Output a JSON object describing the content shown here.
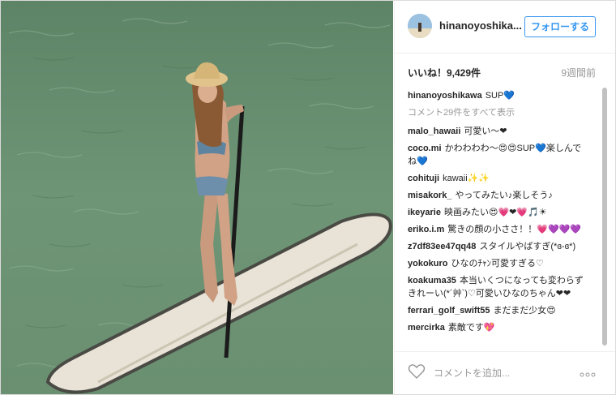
{
  "post": {
    "username": "hinanoyoshika...",
    "follow_label": "フォローする",
    "likes": "いいね！9,429件",
    "time_ago": "9週間前",
    "view_all": "コメント29件をすべて表示",
    "add_comment_placeholder": "コメントを追加...",
    "caption": {
      "user": "hinanoyoshikawa",
      "text": "SUP💙"
    },
    "comments": [
      {
        "user": "malo_hawaii",
        "text": "可愛い〜❤"
      },
      {
        "user": "coco.mi",
        "text": "かわわわわ〜😍😍SUP💙楽しんでね💙"
      },
      {
        "user": "cohituji",
        "text": "kawaii✨✨"
      },
      {
        "user": "misakork_",
        "text": "やってみたい♪楽しそう♪"
      },
      {
        "user": "ikeyarie",
        "text": "映画みたい😍💗❤💗🎵☀"
      },
      {
        "user": "eriko.i.m",
        "text": "驚きの顔の小ささ！！💗💜💜💜"
      },
      {
        "user": "z7df83ee47qq48",
        "text": "スタイルやばすぎ(*ɞ-ɞ*)"
      },
      {
        "user": "yokokuro",
        "text": "ひなのﾁｬﾝ可愛すぎる♡"
      },
      {
        "user": "koakuma35",
        "text": "本当いくつになっても変わらずきれーい(*´艸`)♡可愛いひなのちゃん❤❤"
      },
      {
        "user": "ferrari_golf_swift55",
        "text": "まだまだ少女😍"
      },
      {
        "user": "mercirka",
        "text": "素敵です💖"
      }
    ]
  },
  "icons": {
    "heart": "heart-outline-icon",
    "more": "more-options-icon"
  },
  "colors": {
    "accent": "#3897f0",
    "text": "#262626",
    "muted": "#999999",
    "water": "#6d9273"
  }
}
